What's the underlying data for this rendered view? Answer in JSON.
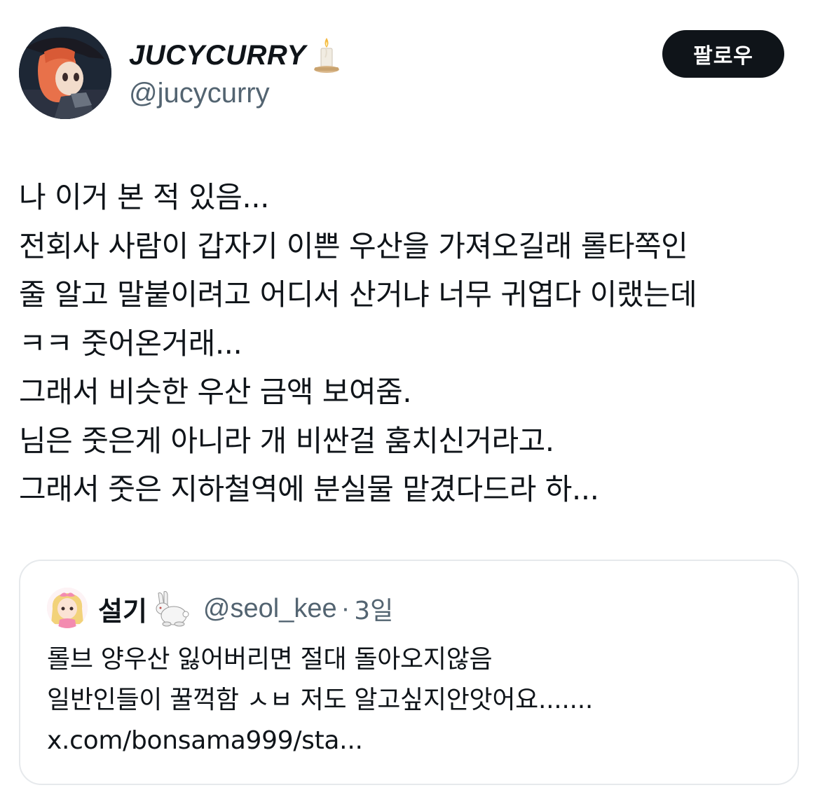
{
  "author": {
    "display_name": "JUCYCURRY",
    "name_emoji": "candle-icon",
    "handle": "@jucycurry"
  },
  "follow_label": "팔로우",
  "tweet_lines": [
    "나 이거 본 적 있음...",
    "전회사 사람이 갑자기 이쁜 우산을 가져오길래 롤타쪽인",
    "줄 알고 말붙이려고 어디서 산거냐 너무 귀엽다 이랬는데",
    "ㅋㅋ 줏어온거래...",
    "그래서 비슷한 우산 금액 보여줌.",
    "님은 줏은게 아니라 개 비싼걸 훔치신거라고.",
    "그래서 줏은 지하철역에 분실물 맡겼다드라 하..."
  ],
  "quote": {
    "display_name": "설기",
    "name_emoji": "rabbit-icon",
    "handle": "@seol_kee",
    "separator": "·",
    "time": "3일",
    "lines": [
      "롤브 양우산 잃어버리면 절대 돌아오지않음",
      "일반인들이 꿀꺽함 ㅅㅂ 저도 알고싶지안앗어요.......",
      "x.com/bonsama999/sta..."
    ]
  },
  "colors": {
    "text_primary": "#0f1419",
    "text_secondary": "#536471",
    "button_bg": "#0f1419",
    "card_border": "#e6e9ec"
  }
}
